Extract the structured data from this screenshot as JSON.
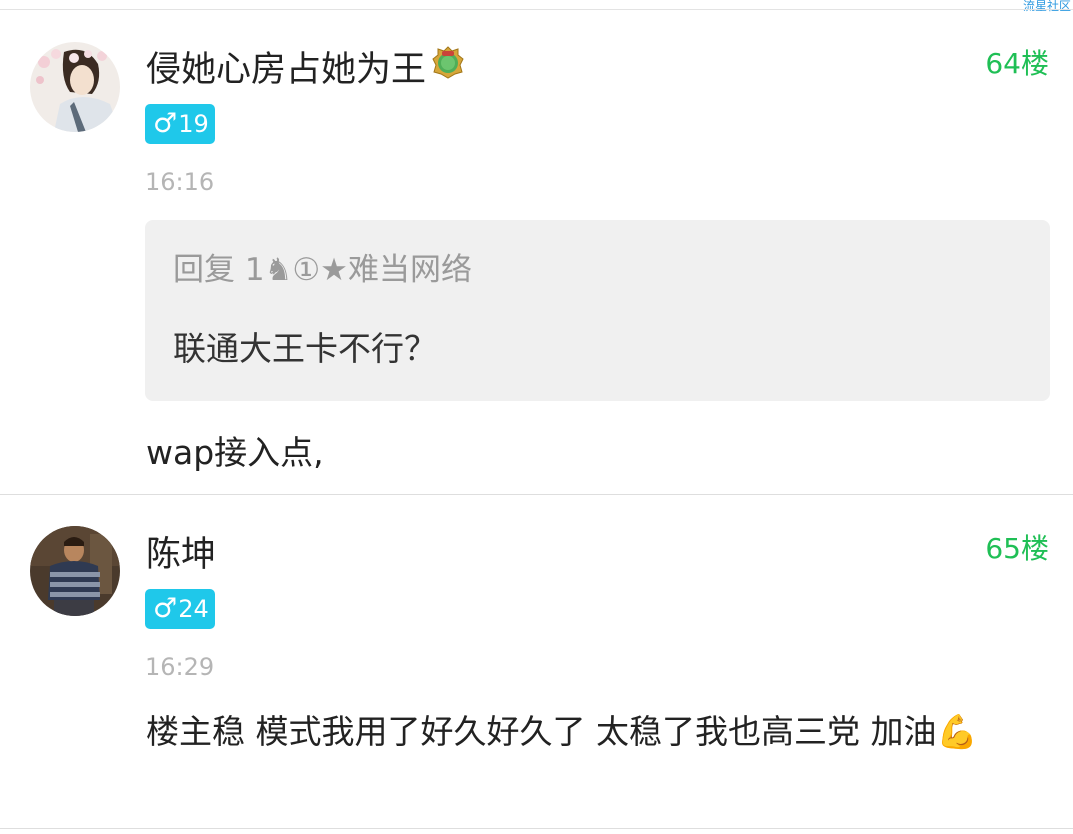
{
  "watermark": "流星社区",
  "posts": [
    {
      "username": "侵她心房占她为王",
      "badge_icon": "level-crest-icon",
      "floor": "64楼",
      "gender_symbol": "♂",
      "age": "19",
      "time": "16:16",
      "quote": {
        "header": "回复 1♞①★难当网络",
        "text": "联通大王卡不行？"
      },
      "content": "wap接入点,"
    },
    {
      "username": "陈坤",
      "floor": "65楼",
      "gender_symbol": "♂",
      "age": "24",
      "time": "16:29",
      "content": "楼主稳 模式我用了好久好久了 太稳了我也高三党 加油💪"
    }
  ],
  "colors": {
    "floor_green": "#1fbf55",
    "badge_blue": "#1fc8ea",
    "time_gray": "#b5b5b5",
    "quote_bg": "#f0f0f0"
  }
}
